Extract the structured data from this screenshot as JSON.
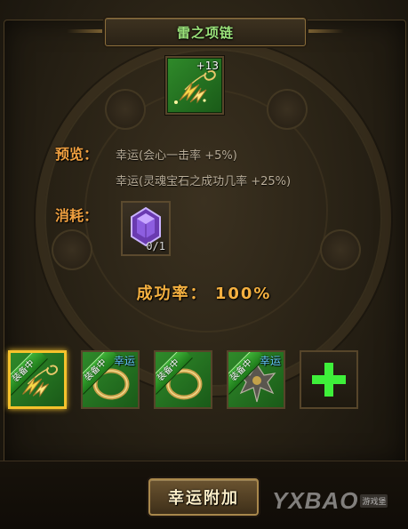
{
  "title": "雷之项链",
  "main_item": {
    "level": "+13",
    "icon": "lightning-necklace-icon"
  },
  "preview": {
    "label": "预览：",
    "lines": [
      "幸运(会心一击率 +5%)",
      "幸运(灵魂宝石之成功几率 +25%)"
    ]
  },
  "cost": {
    "label": "消耗：",
    "item_icon": "purple-soul-gem-icon",
    "count": "0/1"
  },
  "success_rate": "成功率： 100%",
  "equipment_slots": [
    {
      "tag": "装备中",
      "lucky": "",
      "icon": "lightning-necklace-icon",
      "selected": true
    },
    {
      "tag": "装备中",
      "lucky": "幸运",
      "icon": "gold-ring-icon",
      "selected": false
    },
    {
      "tag": "装备中",
      "lucky": "",
      "icon": "gold-ring-icon",
      "selected": false
    },
    {
      "tag": "装备中",
      "lucky": "幸运",
      "icon": "dark-amulet-icon",
      "selected": false
    }
  ],
  "add_slot_icon": "plus-icon",
  "action_button": "幸运附加",
  "watermark": {
    "logo": "YXBAO",
    "sub": "游戏堡"
  },
  "colors": {
    "title_green": "#9ae27a",
    "label_orange": "#f0a040",
    "slot_green": "#2f8a2a",
    "selected_gold": "#f5c22c",
    "lucky_blue": "#64c8ff",
    "plus_green": "#3ef03a"
  }
}
